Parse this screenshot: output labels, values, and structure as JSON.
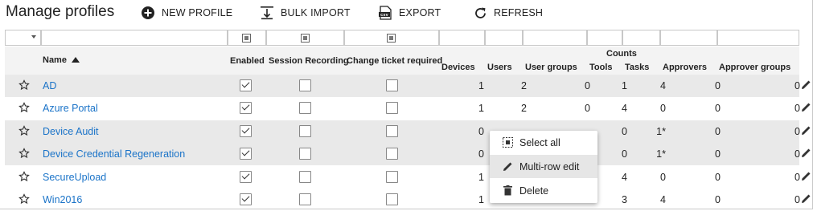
{
  "page_title": "Manage profiles",
  "toolbar": {
    "new_profile": "NEW PROFILE",
    "bulk_import": "BULK IMPORT",
    "export": "EXPORT",
    "refresh": "REFRESH"
  },
  "columns": {
    "name": "Name",
    "enabled": "Enabled",
    "session_recording": "Session Recording",
    "change_ticket": "Change ticket required",
    "counts_group": "Counts",
    "devices": "Devices",
    "users": "Users",
    "user_groups": "User groups",
    "tools": "Tools",
    "tasks": "Tasks",
    "approvers": "Approvers",
    "approver_groups": "Approver groups"
  },
  "sort": {
    "column": "Name",
    "direction": "ascending"
  },
  "rows": [
    {
      "name": "AD",
      "enabled": true,
      "session": false,
      "ticket": false,
      "devices": "1",
      "users": "2",
      "user_groups": "0",
      "tools": "1",
      "tasks": "4",
      "approvers": "0",
      "approver_groups": "0"
    },
    {
      "name": "Azure Portal",
      "enabled": true,
      "session": false,
      "ticket": false,
      "devices": "1",
      "users": "2",
      "user_groups": "0",
      "tools": "4",
      "tasks": "0",
      "approvers": "0",
      "approver_groups": "0"
    },
    {
      "name": "Device Audit",
      "enabled": true,
      "session": false,
      "ticket": false,
      "devices": "0",
      "users": "",
      "user_groups": "",
      "tools": "0",
      "tasks": "1*",
      "approvers": "0",
      "approver_groups": "0"
    },
    {
      "name": "Device Credential Regeneration",
      "enabled": true,
      "session": false,
      "ticket": false,
      "devices": "0",
      "users": "",
      "user_groups": "",
      "tools": "0",
      "tasks": "1*",
      "approvers": "0",
      "approver_groups": "0"
    },
    {
      "name": "SecureUpload",
      "enabled": true,
      "session": false,
      "ticket": false,
      "devices": "1",
      "users": "",
      "user_groups": "",
      "tools": "4",
      "tasks": "0",
      "approvers": "0",
      "approver_groups": "0"
    },
    {
      "name": "Win2016",
      "enabled": true,
      "session": false,
      "ticket": false,
      "devices": "1",
      "users": "",
      "user_groups": "",
      "tools": "3",
      "tasks": "4",
      "approvers": "0",
      "approver_groups": "0"
    }
  ],
  "context_menu": {
    "select_all": "Select all",
    "multi_row_edit": "Multi-row edit",
    "delete": "Delete",
    "hovered_item": "Multi-row edit"
  },
  "icons": {
    "new": "plus-circle-icon",
    "import": "bulk-import-icon",
    "export": "csv-export-icon",
    "refresh": "refresh-icon",
    "favorite": "star-outline-icon",
    "edit": "pencil-icon"
  },
  "colors": {
    "link": "#1a73c8",
    "alt_row": "#e9e9e9",
    "header_bg": "#f3f3f3"
  }
}
